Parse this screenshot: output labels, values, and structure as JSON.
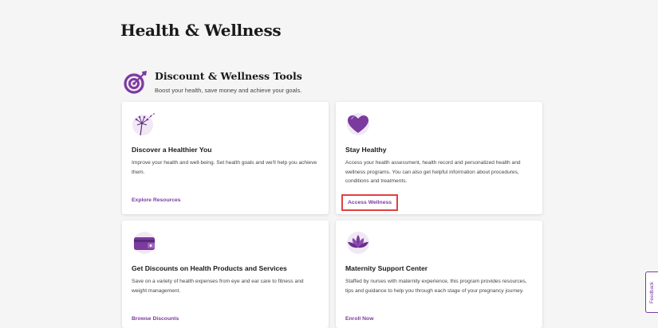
{
  "page": {
    "title": "Health & Wellness"
  },
  "section": {
    "icon": "target-icon",
    "title": "Discount & Wellness Tools",
    "subtitle": "Boost your health, save money and achieve your goals."
  },
  "cards": [
    {
      "icon": "dandelion-icon",
      "title": "Discover a Healthier You",
      "description": "Improve your health and well-being. Set health goals and we'll help you achieve them.",
      "link": "Explore Resources"
    },
    {
      "icon": "heart-icon",
      "title": "Stay Healthy",
      "description": "Access your health assessment, health record and personalized health and wellness programs. You can also get helpful information about procedures, conditions and treatments.",
      "link": "Access Wellness"
    },
    {
      "icon": "wallet-card-icon",
      "title": "Get Discounts on Health Products and Services",
      "description": "Save on a variety of health expenses from eye and ear care to fitness and weight management.",
      "link": "Browse Discounts"
    },
    {
      "icon": "lotus-icon",
      "title": "Maternity Support Center",
      "description": "Staffed by nurses with maternity experience, this program provides resources, tips and guidance to help you through each stage of your pregnancy journey.",
      "link": "Enroll Now"
    }
  ],
  "feedback": {
    "label": "Feedback"
  },
  "colors": {
    "accent": "#7b3b9e",
    "highlight": "#e0413f",
    "background": "#f5f5f5"
  }
}
